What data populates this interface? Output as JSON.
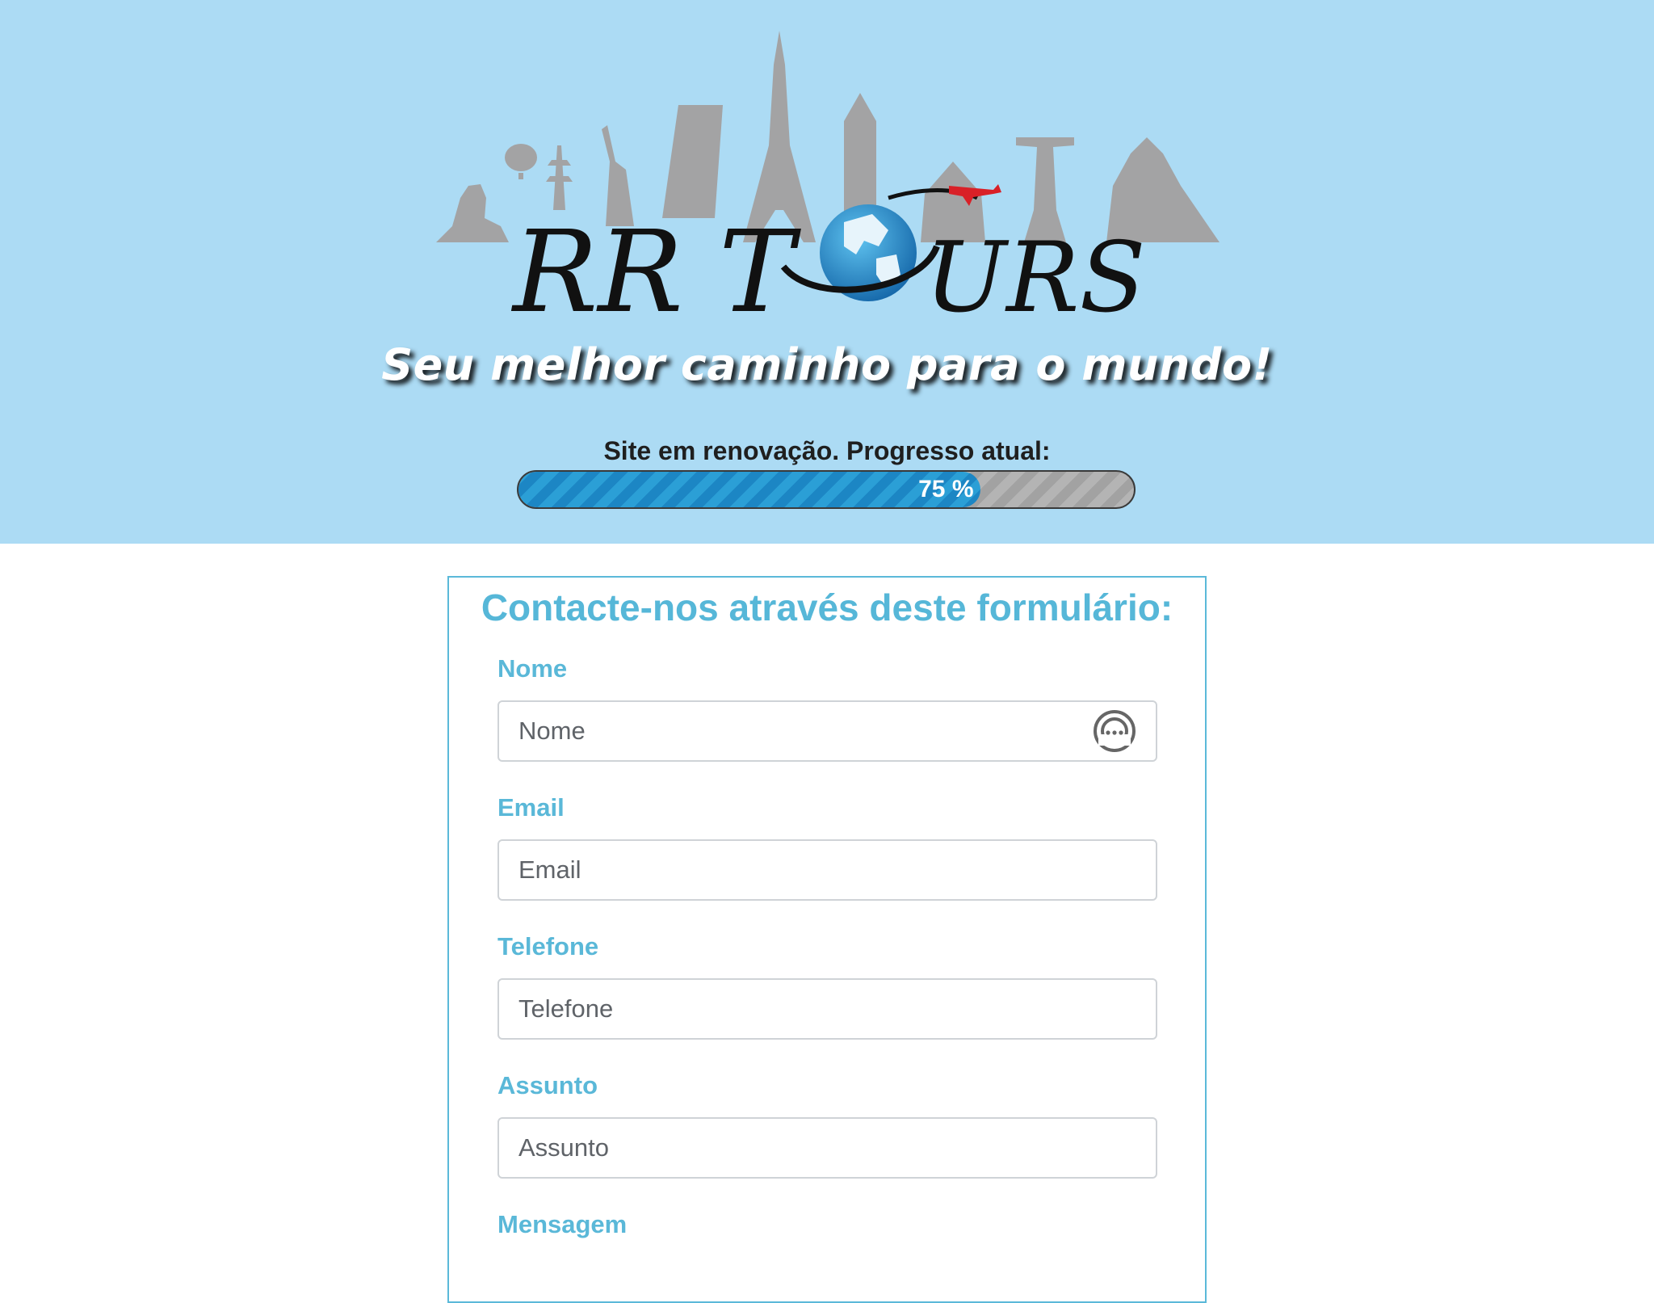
{
  "brand": {
    "name": "RR TOURS"
  },
  "hero": {
    "tagline": "Seu melhor caminho para o mundo!",
    "progress_label": "Site em renovação. Progresso atual:",
    "progress_value": 75,
    "progress_text": "75 %"
  },
  "form": {
    "title": "Contacte-nos através deste formulário:",
    "fields": [
      {
        "label": "Nome",
        "placeholder": "Nome"
      },
      {
        "label": "Email",
        "placeholder": "Email"
      },
      {
        "label": "Telefone",
        "placeholder": "Telefone"
      },
      {
        "label": "Assunto",
        "placeholder": "Assunto"
      },
      {
        "label": "Mensagem"
      }
    ]
  },
  "colors": {
    "hero_bg": "#acdbf4",
    "accent": "#56b7d8",
    "progress_fill": "#2b9fd6"
  },
  "icons": {
    "password_manager": "password-manager-icon"
  }
}
